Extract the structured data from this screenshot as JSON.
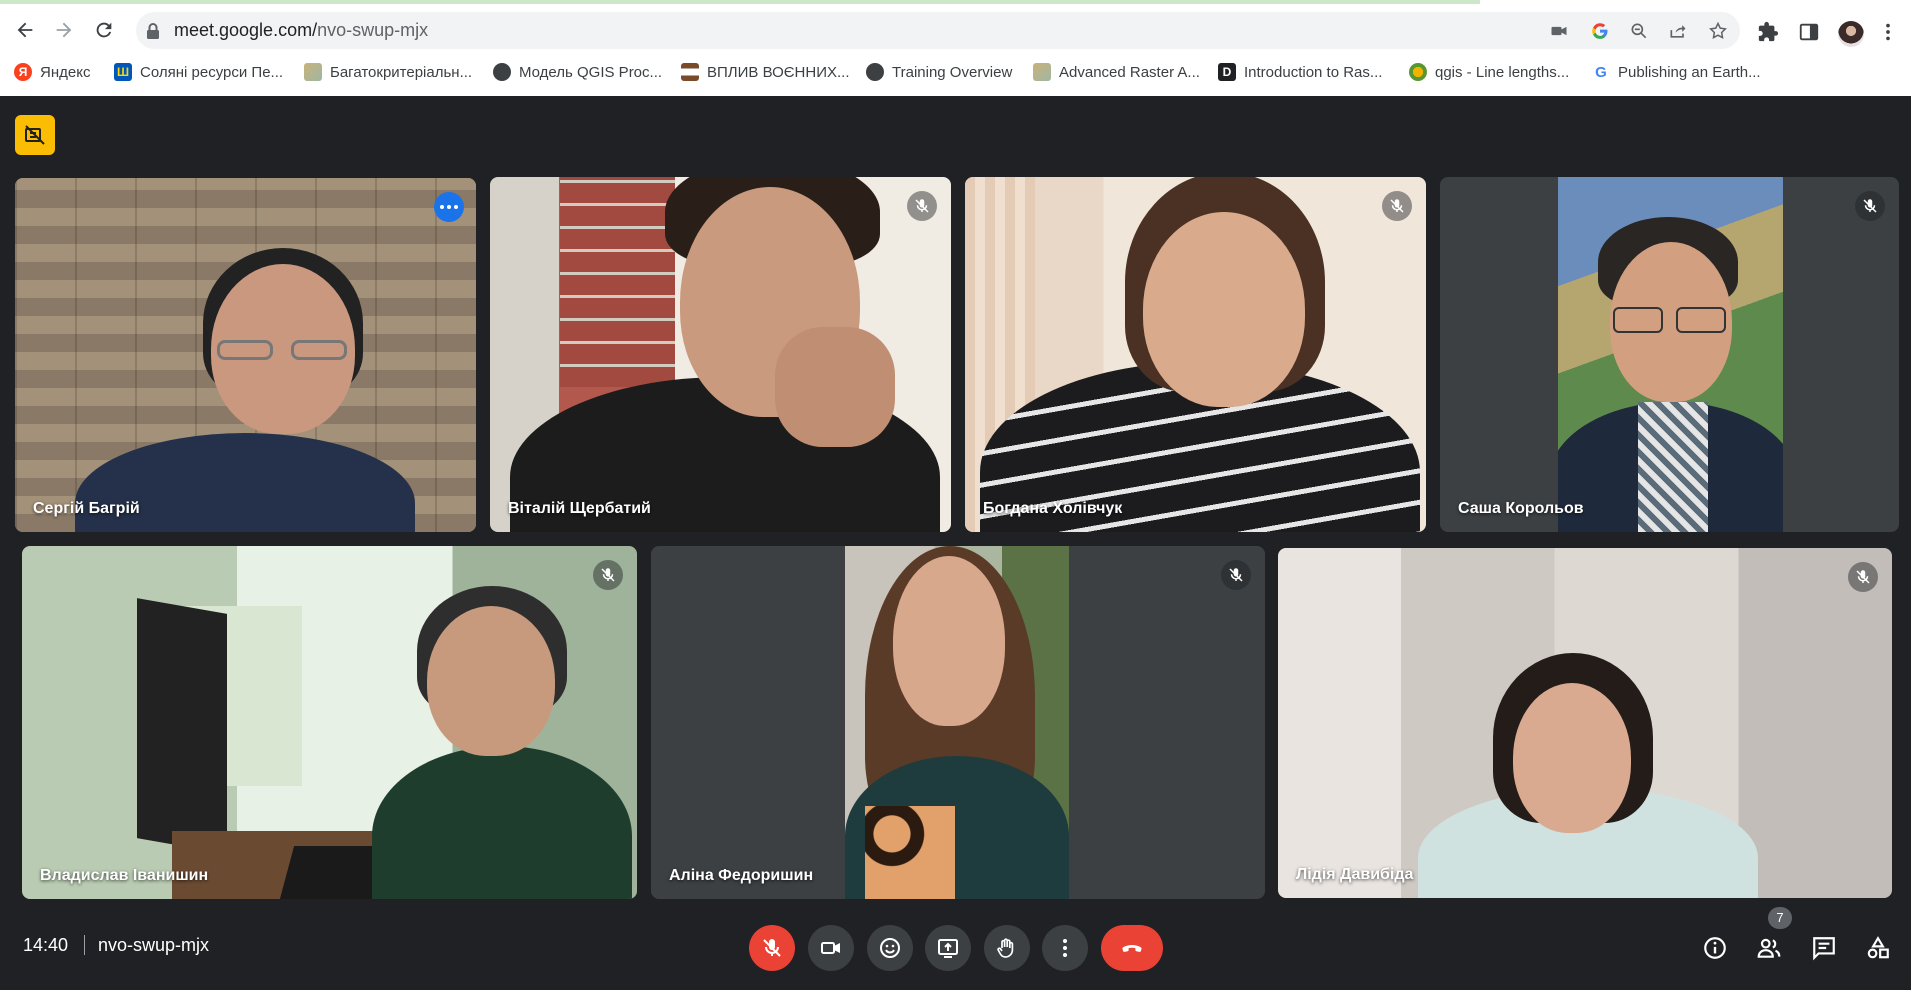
{
  "browser": {
    "url_host": "meet.google.com/",
    "url_path": "nvo-swup-mjx",
    "bookmarks": [
      {
        "label": "Яндекс",
        "icon": "yandex-icon"
      },
      {
        "label": "Соляні ресурси Пе...",
        "icon": "trident-icon"
      },
      {
        "label": "Багатокритеріальн...",
        "icon": "map-icon"
      },
      {
        "label": "Модель QGIS Proc...",
        "icon": "globe-icon"
      },
      {
        "label": "ВПЛИВ ВОЄННИХ...",
        "icon": "stripe-icon"
      },
      {
        "label": "Training Overview",
        "icon": "globe-icon"
      },
      {
        "label": "Advanced Raster A...",
        "icon": "map-icon"
      },
      {
        "label": "Introduction to Ras...",
        "icon": "d-icon"
      },
      {
        "label": "qgis - Line lengths...",
        "icon": "qgis-icon"
      },
      {
        "label": "Publishing an Earth...",
        "icon": "google-icon"
      }
    ]
  },
  "meeting": {
    "clock": "14:40",
    "code": "nvo-swup-mjx",
    "people_count": "7",
    "participants": [
      {
        "name": "Сергій Багрій",
        "active": true,
        "muted": false
      },
      {
        "name": "Віталій Щербатий",
        "muted": true
      },
      {
        "name": "Богдана Холівчук",
        "muted": true
      },
      {
        "name": "Саша Корольов",
        "muted": true
      },
      {
        "name": "Владислав Іванишин",
        "muted": true
      },
      {
        "name": "Аліна Федоришин",
        "muted": true
      },
      {
        "name": "Лідія Давибіда",
        "muted": true
      }
    ]
  },
  "colors": {
    "background": "#202124",
    "tile": "#3c4043",
    "accent_blue": "#8ab4f8",
    "hangup_red": "#ea4335",
    "badge_yellow": "#fbbc04"
  }
}
